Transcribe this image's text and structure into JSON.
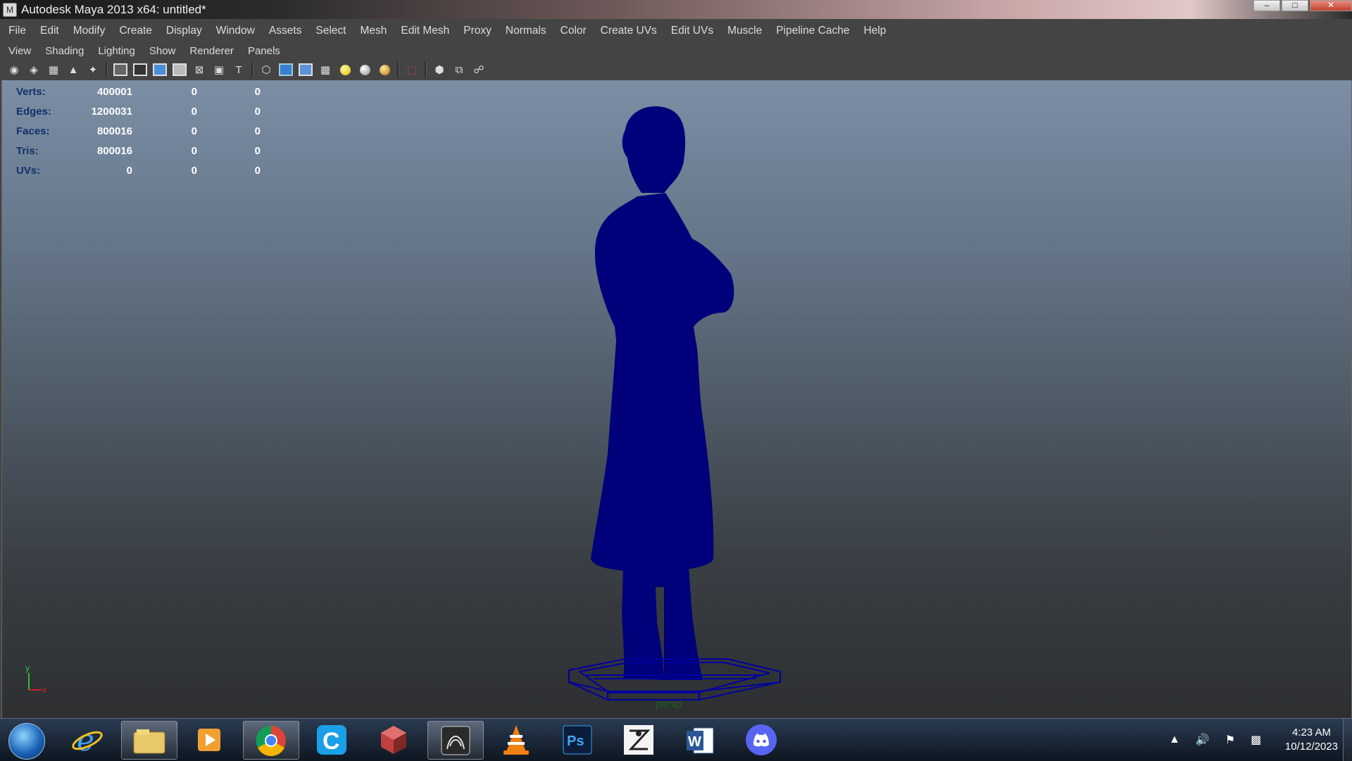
{
  "window": {
    "title": "Autodesk Maya 2013 x64: untitled*"
  },
  "menubar": {
    "items": [
      "File",
      "Edit",
      "Modify",
      "Create",
      "Display",
      "Window",
      "Assets",
      "Select",
      "Mesh",
      "Edit Mesh",
      "Proxy",
      "Normals",
      "Color",
      "Create UVs",
      "Edit UVs",
      "Muscle",
      "Pipeline Cache",
      "Help"
    ]
  },
  "panel_menu": {
    "items": [
      "View",
      "Shading",
      "Lighting",
      "Show",
      "Renderer",
      "Panels"
    ]
  },
  "hud": {
    "rows": [
      {
        "label": "Verts:",
        "v1": "400001",
        "v2": "0",
        "v3": "0"
      },
      {
        "label": "Edges:",
        "v1": "1200031",
        "v2": "0",
        "v3": "0"
      },
      {
        "label": "Faces:",
        "v1": "800016",
        "v2": "0",
        "v3": "0"
      },
      {
        "label": "Tris:",
        "v1": "800016",
        "v2": "0",
        "v3": "0"
      },
      {
        "label": "UVs:",
        "v1": "0",
        "v2": "0",
        "v3": "0"
      }
    ]
  },
  "viewport": {
    "camera_label": "persp",
    "axis_y": "y",
    "axis_x": "x",
    "mesh_color": "#00007a"
  },
  "taskbar": {
    "apps": [
      "internet-explorer",
      "file-explorer",
      "media-player",
      "chrome",
      "ccleaner",
      "modeling-app",
      "maya",
      "vlc",
      "photoshop",
      "zbrush",
      "word",
      "discord"
    ],
    "ps_label": "Ps",
    "word_label": "W"
  },
  "clock": {
    "time": "4:23 AM",
    "date": "10/12/2023"
  }
}
